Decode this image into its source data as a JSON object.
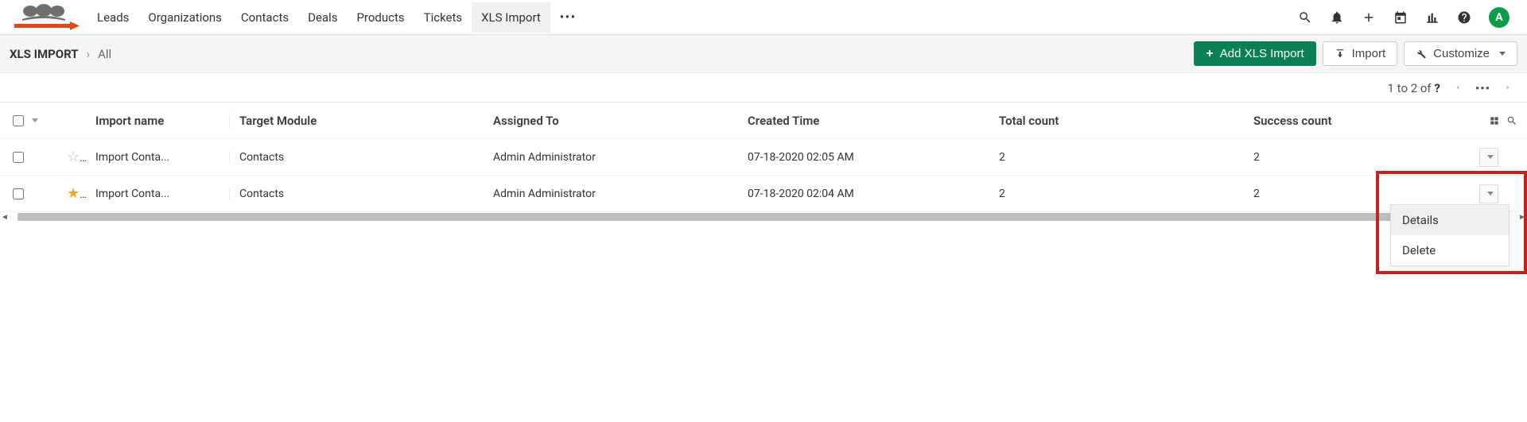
{
  "nav": {
    "items": [
      "Leads",
      "Organizations",
      "Contacts",
      "Deals",
      "Products",
      "Tickets",
      "XLS Import"
    ],
    "active_index": 6,
    "more_glyph": "•••"
  },
  "avatar_letter": "A",
  "breadcrumb": {
    "root": "XLS IMPORT",
    "sep": "›",
    "leaf": "All"
  },
  "toolbar": {
    "add_label": "Add XLS Import",
    "import_label": "Import",
    "customize_label": "Customize"
  },
  "pagination": {
    "text_prefix": "1 to 2  of ",
    "total_glyph": "?",
    "more_glyph": "•••"
  },
  "table": {
    "headers": {
      "name": "Import name",
      "module": "Target Module",
      "assigned": "Assigned To",
      "created": "Created Time",
      "total": "Total count",
      "success": "Success count"
    },
    "rows": [
      {
        "starred": false,
        "name": "Import Conta...",
        "module": "Contacts",
        "assigned": "Admin Administrator",
        "created": "07-18-2020 02:05 AM",
        "total": "2",
        "success": "2"
      },
      {
        "starred": true,
        "name": "Import Conta...",
        "module": "Contacts",
        "assigned": "Admin Administrator",
        "created": "07-18-2020 02:04 AM",
        "total": "2",
        "success": "2"
      }
    ]
  },
  "context_menu": {
    "details": "Details",
    "delete": "Delete"
  }
}
